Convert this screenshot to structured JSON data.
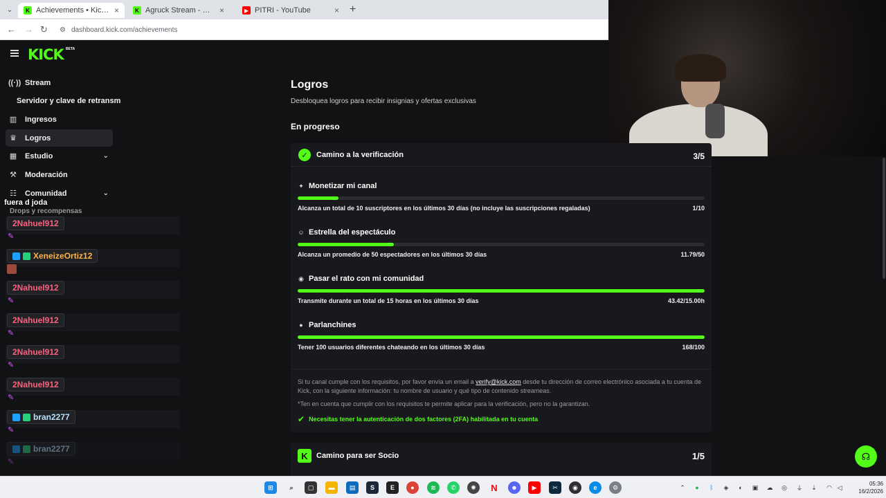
{
  "browser": {
    "tabs": [
      {
        "title": "Achievements • Kick Dashboard",
        "favicon": "kick-favicon",
        "active": true
      },
      {
        "title": "Agruck Stream - Watch Live on",
        "favicon": "kick-favicon",
        "active": false
      },
      {
        "title": "PITRI - YouTube",
        "favicon": "youtube-favicon",
        "active": false
      }
    ],
    "url": "dashboard.kick.com/achievements"
  },
  "header": {
    "logo": "KICK",
    "beta": "BETA"
  },
  "sidebar": {
    "items": [
      {
        "label": "Stream",
        "icon": "broadcast-icon"
      },
      {
        "label": "Servidor y clave de retransm"
      },
      {
        "label": "Ingresos",
        "icon": "chart-icon"
      },
      {
        "label": "Logros",
        "icon": "trophy-icon"
      },
      {
        "label": "Estudio",
        "icon": "studio-icon"
      },
      {
        "label": "Moderación",
        "icon": "wrench-icon"
      },
      {
        "label": "Comunidad",
        "icon": "community-icon"
      },
      {
        "label": "Drops y recompensas"
      }
    ]
  },
  "chat": {
    "title": "fuera d joda",
    "messages": [
      {
        "user": "2Nahuel912"
      },
      {
        "user": "XeneizeOrtiz12"
      },
      {
        "user": "2Nahuel912"
      },
      {
        "user": "2Nahuel912"
      },
      {
        "user": "2Nahuel912"
      },
      {
        "user": "2Nahuel912"
      },
      {
        "user": "bran2277"
      },
      {
        "user": "bran2277"
      }
    ]
  },
  "main": {
    "title": "Logros",
    "subtitle": "Desbloquea logros para recibir insignias y ofertas exclusivas",
    "section": "En progreso",
    "verification_card": {
      "title": "Camino a la verificación",
      "progress": "3/5",
      "goals": [
        {
          "title": "Monetizar mi canal",
          "icon": "sparkle-icon",
          "description": "Alcanza un total de 10 suscriptores en los últimos 30 días (no incluye las suscripciones regaladas)",
          "value": "1/10",
          "fraction": 0.1
        },
        {
          "title": "Estrella del espectáculo",
          "icon": "viewers-icon",
          "description": "Alcanza un promedio de 50 espectadores en los últimos 30 días",
          "value": "11.79/50",
          "fraction": 0.236
        },
        {
          "title": "Pasar el rato con mi comunidad",
          "icon": "broadcast-icon",
          "description": "Transmite durante un total de 15 horas en los últimos 30 días",
          "value": "43.42/15.00h",
          "fraction": 1
        },
        {
          "title": "Parlanchines",
          "icon": "chat-bubble-icon",
          "description": "Tener 100 usuarios diferentes chateando en los últimos 30 días",
          "value": "168/100",
          "fraction": 1
        }
      ],
      "info_prefix": "Si tu canal cumple con los requisitos, por favor envía un email a ",
      "info_email": "verify@kick.com",
      "info_suffix": " desde tu dirección de correo electrónico asociada a tu cuenta de Kick, con la siguiente información: tu nombre de usuario y qué tipo de contenido streameas.",
      "info_note": "*Ten en cuenta que cumplir con los requisitos te permite aplicar para la verificación, pero no la garantizan.",
      "requirement": "Necesitas tener la autenticación de dos factores (2FA) habilitada en tu cuenta"
    },
    "partner_card": {
      "title": "Camino para ser Socio",
      "progress": "1/5"
    }
  },
  "taskbar": {
    "time": "05:36",
    "date": "16/2/2026"
  },
  "colors": {
    "accent": "#53fc18",
    "background": "#111214",
    "card": "#18191c"
  }
}
